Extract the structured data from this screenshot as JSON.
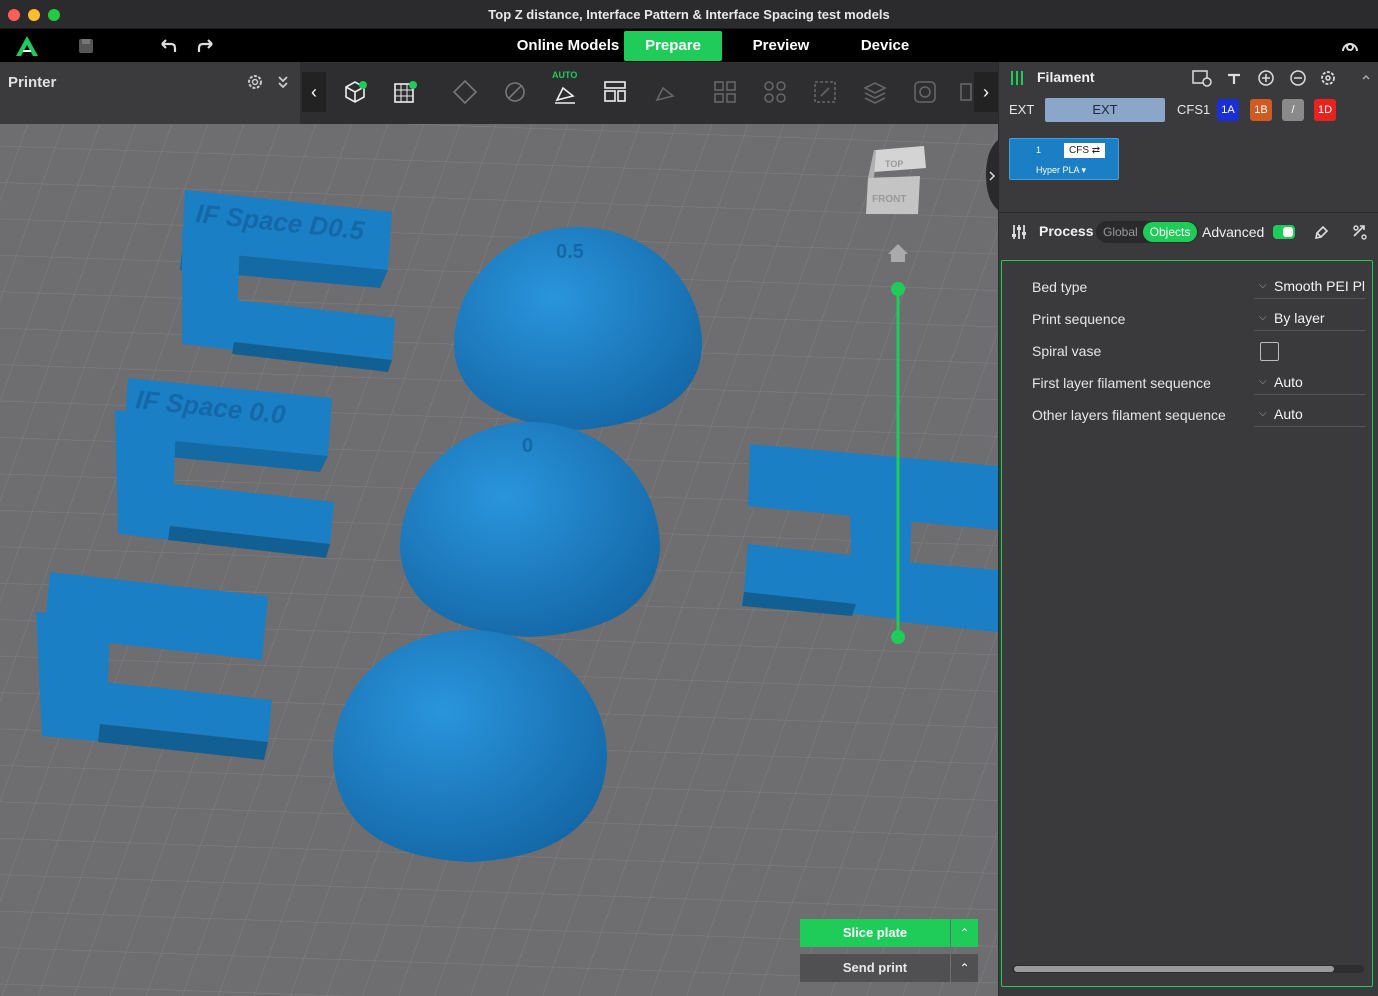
{
  "window": {
    "title": "Top Z distance, Interface Pattern & Interface Spacing test models"
  },
  "nav": {
    "tabs": [
      "Online Models",
      "Prepare",
      "Preview",
      "Device"
    ],
    "active": "Prepare"
  },
  "printer": {
    "label": "Printer"
  },
  "toolbar": {
    "auto_label": "AUTO"
  },
  "viewport": {
    "view_cube": {
      "top": "TOP",
      "front": "FRONT"
    },
    "model_labels": [
      "IF Space D0.5",
      "IF Space 0.0",
      "0.5",
      "0"
    ]
  },
  "filament": {
    "title": "Filament",
    "ext_label": "EXT",
    "ext_button": "EXT",
    "cfs_label": "CFS1",
    "chips": [
      {
        "label": "1A",
        "color": "#1a2fd6"
      },
      {
        "label": "1B",
        "color": "#d05a20"
      },
      {
        "label": "/",
        "color": "#8a8a8a"
      },
      {
        "label": "1D",
        "color": "#e8231e"
      }
    ],
    "slot": {
      "index": "1",
      "tag": "CFS ⇄",
      "material": "Hyper PLA ▾"
    }
  },
  "process": {
    "title": "Process",
    "toggle_global": "Global",
    "toggle_objects": "Objects",
    "advanced_label": "Advanced",
    "rows": [
      {
        "label": "Bed type",
        "value": "Smooth PEI Pl."
      },
      {
        "label": "Print sequence",
        "value": "By layer"
      },
      {
        "label": "Spiral vase",
        "value": ""
      },
      {
        "label": "First layer filament sequence",
        "value": "Auto"
      },
      {
        "label": "Other layers filament sequence",
        "value": "Auto"
      }
    ]
  },
  "actions": {
    "slice": "Slice plate",
    "send": "Send print"
  },
  "colors": {
    "accent": "#1fcc5a",
    "model": "#1a7fc4",
    "bed": "#6e6e70"
  }
}
